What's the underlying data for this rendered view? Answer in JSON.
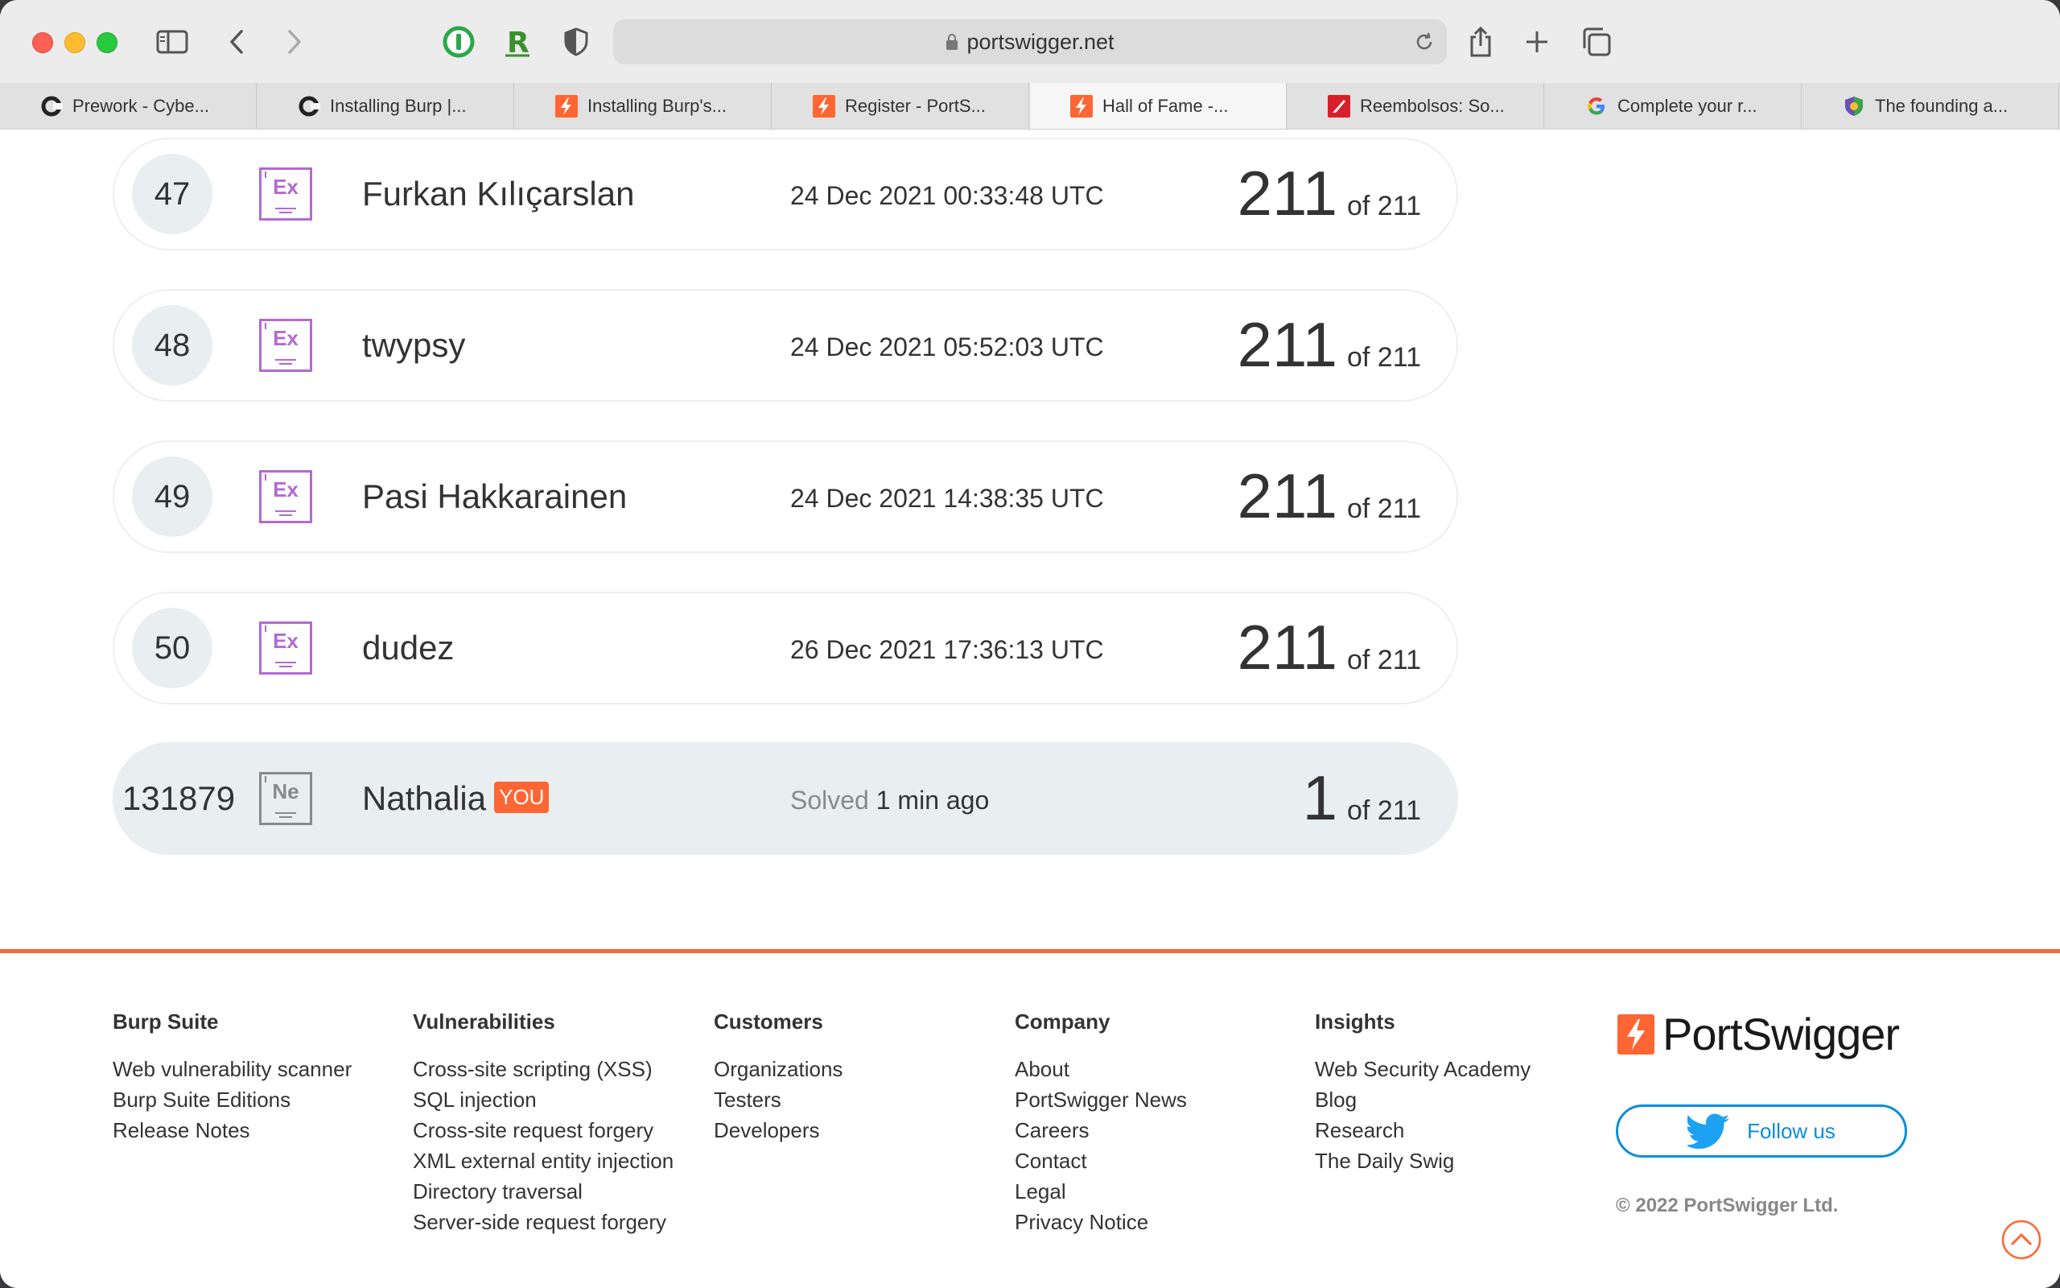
{
  "browser": {
    "url": "portswigger.net",
    "tabs": [
      {
        "label": "Prework - Cybe...",
        "active": false,
        "icon": "c-icon"
      },
      {
        "label": "Installing Burp |...",
        "active": false,
        "icon": "c-icon"
      },
      {
        "label": "Installing Burp's...",
        "active": false,
        "icon": "portswigger-icon"
      },
      {
        "label": "Register - PortS...",
        "active": false,
        "icon": "portswigger-icon"
      },
      {
        "label": "Hall of Fame -...",
        "active": true,
        "icon": "portswigger-icon"
      },
      {
        "label": "Reembolsos: So...",
        "active": false,
        "icon": "red-icon"
      },
      {
        "label": "Complete your r...",
        "active": false,
        "icon": "google-icon"
      },
      {
        "label": "The founding a...",
        "active": false,
        "icon": "shield-icon"
      }
    ]
  },
  "leaderboard": [
    {
      "rank": "47",
      "badge": "Ex",
      "name": "Furkan Kılıçarslan",
      "time": "24 Dec 2021 00:33:48 UTC",
      "score": "211",
      "of": "of 211"
    },
    {
      "rank": "48",
      "badge": "Ex",
      "name": "twypsy",
      "time": "24 Dec 2021 05:52:03 UTC",
      "score": "211",
      "of": "of 211"
    },
    {
      "rank": "49",
      "badge": "Ex",
      "name": "Pasi Hakkarainen",
      "time": "24 Dec 2021 14:38:35 UTC",
      "score": "211",
      "of": "of 211"
    },
    {
      "rank": "50",
      "badge": "Ex",
      "name": "dudez",
      "time": "26 Dec 2021 17:36:13 UTC",
      "score": "211",
      "of": "of 211"
    }
  ],
  "you_row": {
    "rank": "131879",
    "badge": "Ne",
    "name": "Nathalia",
    "tag": "YOU",
    "solved_label": "Solved",
    "solved_time": "1 min ago",
    "score": "1",
    "of": "of 211"
  },
  "footer": {
    "columns": [
      {
        "heading": "Burp Suite",
        "links": [
          "Web vulnerability scanner",
          "Burp Suite Editions",
          "Release Notes"
        ]
      },
      {
        "heading": "Vulnerabilities",
        "links": [
          "Cross-site scripting (XSS)",
          "SQL injection",
          "Cross-site request forgery",
          "XML external entity injection",
          "Directory traversal",
          "Server-side request forgery"
        ]
      },
      {
        "heading": "Customers",
        "links": [
          "Organizations",
          "Testers",
          "Developers"
        ]
      },
      {
        "heading": "Company",
        "links": [
          "About",
          "PortSwigger News",
          "Careers",
          "Contact",
          "Legal",
          "Privacy Notice"
        ]
      },
      {
        "heading": "Insights",
        "links": [
          "Web Security Academy",
          "Blog",
          "Research",
          "The Daily Swig"
        ]
      }
    ],
    "brand": "PortSwigger",
    "follow_label": "Follow us",
    "copyright": "© 2022 PortSwigger Ltd."
  },
  "colors": {
    "accent": "#ff6633",
    "expert_badge": "#b36ad1",
    "twitter_blue": "#0a8ddb"
  }
}
